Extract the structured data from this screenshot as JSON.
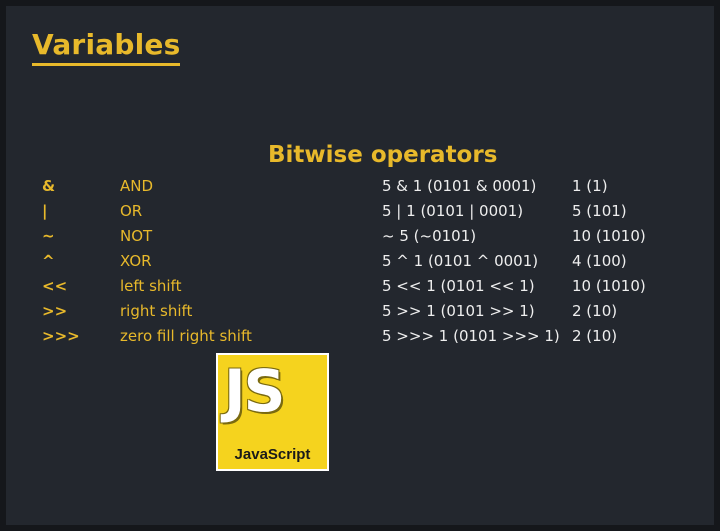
{
  "heading": "Variables",
  "subheading": "Bitwise operators",
  "operators": [
    {
      "symbol": "&",
      "name": "AND",
      "expression": "5 & 1 (0101 & 0001)",
      "result": "1 (1)"
    },
    {
      "symbol": "|",
      "name": "OR",
      "expression": "5 | 1 (0101 | 0001)",
      "result": "5 (101)"
    },
    {
      "symbol": "~",
      "name": "NOT",
      "expression": "~ 5 (~0101)",
      "result": "10 (1010)"
    },
    {
      "symbol": "^",
      "name": "XOR",
      "expression": "5 ^ 1 (0101 ^ 0001)",
      "result": "4 (100)"
    },
    {
      "symbol": "<<",
      "name": "left shift",
      "expression": "5 << 1 (0101 << 1)",
      "result": "10 (1010)"
    },
    {
      "symbol": ">>",
      "name": "right shift",
      "expression": "5 >> 1 (0101 >> 1)",
      "result": "2 (10)"
    },
    {
      "symbol": ">>>",
      "name": "zero fill right shift",
      "expression": "5 >>> 1 (0101 >>> 1)",
      "result": "2 (10)"
    }
  ],
  "logo": {
    "letters": "JS",
    "name": "JavaScript"
  },
  "colors": {
    "background": "#23272e",
    "accent": "#e8b92b",
    "text": "#eeeeee",
    "logo_bg": "#f5d31e"
  }
}
